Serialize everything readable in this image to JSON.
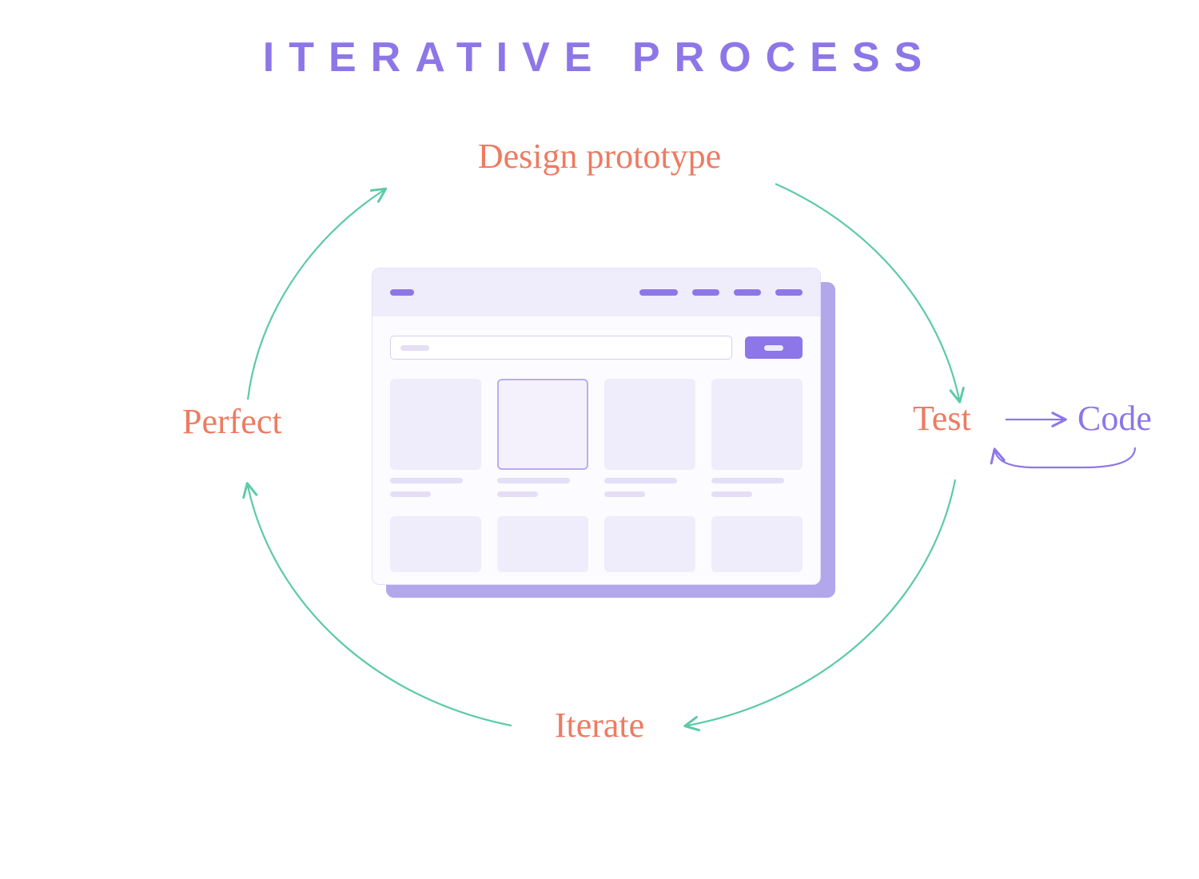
{
  "title": "ITERATIVE PROCESS",
  "steps": {
    "design": "Design prototype",
    "test": "Test",
    "code": "Code",
    "iterate": "Iterate",
    "perfect": "Perfect"
  },
  "colors": {
    "purple": "#8d76e8",
    "coral": "#ed7b62",
    "teal": "#5ccaa7"
  },
  "cycle_order": [
    "Design prototype",
    "Test",
    "Iterate",
    "Perfect"
  ],
  "branch": {
    "from": "Test",
    "to": "Code",
    "returns": true
  }
}
